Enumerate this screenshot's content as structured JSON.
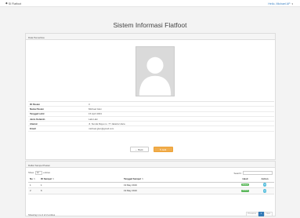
{
  "topbar": {
    "brand": "SI Flatfoot",
    "user_name": "Hello, Michael AP",
    "user_caret": "▾"
  },
  "page_title": "Sistem Informasi Flatfoot",
  "detail_panel": {
    "heading": "Data Pemeriksa",
    "fields": [
      {
        "key": "ID Pasien",
        "value": "3"
      },
      {
        "key": "Nama Pasien",
        "value": "Michael Glen"
      },
      {
        "key": "Tanggal Lahir",
        "value": "15 April 2004"
      },
      {
        "key": "Jenis Kelamin",
        "value": "Laki-Laki"
      },
      {
        "key": "Alamat",
        "value": "Jl. Sunda Raya no. 77 Jakarta Utara"
      },
      {
        "key": "Email",
        "value": "michael.glen@gmail.com"
      }
    ],
    "back_label": "Back",
    "edit_label": "Edit"
  },
  "list_panel": {
    "heading": "Daftar Sampel Pasien",
    "show_label": "Show",
    "entries_value": "10",
    "entries_label": "entries",
    "search_label": "Search:",
    "columns": [
      "No",
      "ID Sampel",
      "Tanggal Sampel",
      "Hasil",
      "Action"
    ],
    "rows": [
      {
        "no": "1",
        "id": "1",
        "date": "19 May 2019",
        "status": "Normal"
      },
      {
        "no": "2",
        "id": "6",
        "date": "19 May 2019",
        "status": "Normal"
      }
    ],
    "footer_text": "Showing 1 to 2 of 2 entries",
    "pagination": {
      "prev": "Previous",
      "current": "1",
      "next": "Next"
    }
  },
  "colors": {
    "accent": "#337ab7",
    "warning": "#f0ad4e",
    "success": "#5cb85c",
    "info": "#5bc0de"
  },
  "icons": {
    "brand": "foot-icon",
    "back": "arrow-left-icon",
    "edit": "pencil-icon",
    "action": "eye-icon"
  }
}
